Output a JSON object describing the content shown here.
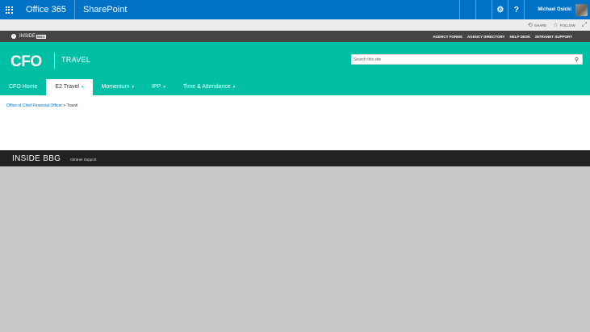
{
  "suite": {
    "brand": "Office 365",
    "app": "SharePoint",
    "gear_glyph": "⚙",
    "help_glyph": "?",
    "user_name": "Michael Osicki"
  },
  "ribbon": {
    "share_label": "SHARE",
    "follow_label": "FOLLOW",
    "share_glyph": "⟲",
    "follow_glyph": "☆",
    "focus_glyph": "⤢"
  },
  "darkbar": {
    "inside_label": "INSIDE",
    "inside_badge": "BBG",
    "links": [
      "AGENCY FORMS",
      "AGENCY DIRECTORY",
      "HELP DESK",
      "INTRANET SUPPORT"
    ]
  },
  "header": {
    "logo": "CFO",
    "site_title": "TRAVEL",
    "search_placeholder": "Search this site",
    "search_value": ""
  },
  "nav": {
    "items": [
      {
        "label": "CFO Home"
      },
      {
        "label": "E2 Travel"
      },
      {
        "label": "Momentum"
      },
      {
        "label": "IPP"
      },
      {
        "label": "Time & Attendance"
      }
    ],
    "caret_glyph": "▾"
  },
  "breadcrumb": {
    "parent": "Office of Chief Financial Officer",
    "separator": ">",
    "current": "Travel"
  },
  "footer": {
    "brand": "INSIDE BBG",
    "link": "Intranet Support"
  },
  "colors": {
    "suite_blue": "#0072c6",
    "teal": "#00bfa5",
    "dark_bar": "#444444",
    "footer": "#222222",
    "background": "#c8c8c8"
  },
  "icons": {
    "waffle": "app-launcher-icon",
    "gear": "gear-icon",
    "help": "help-icon",
    "search": "search-icon"
  }
}
